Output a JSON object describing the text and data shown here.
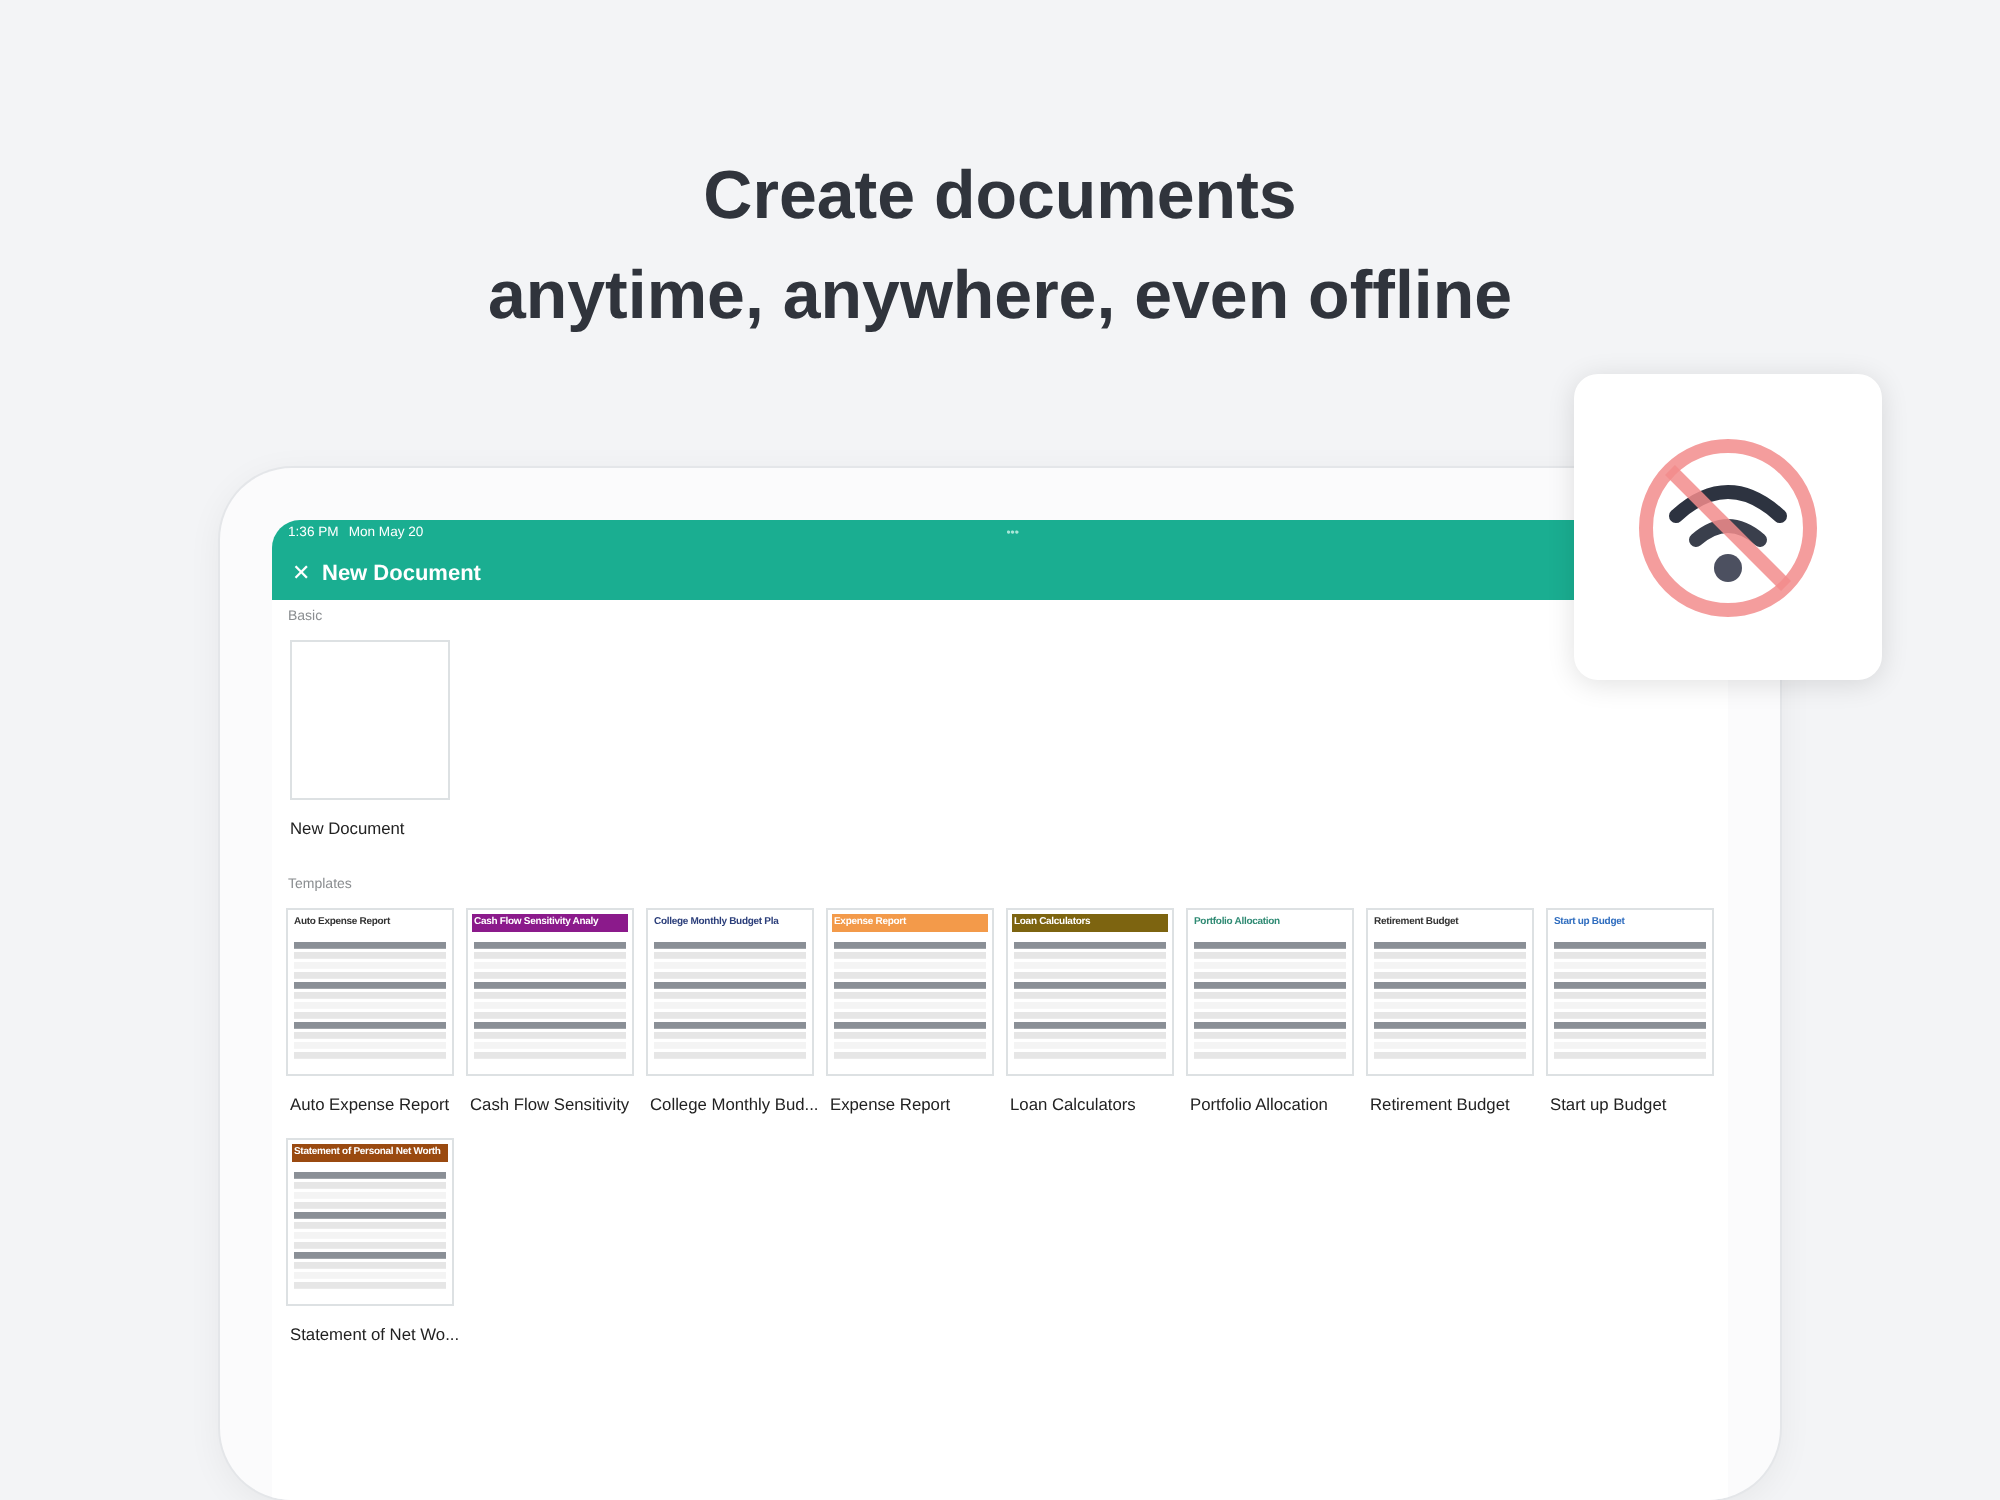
{
  "headline": [
    "Create documents",
    "anytime, anywhere, even offline"
  ],
  "status_bar": {
    "time": "1:36 PM",
    "date": "Mon May 20",
    "dots": "•••"
  },
  "title_bar": {
    "close": "✕",
    "title": "New Document"
  },
  "sections": [
    {
      "label": "Basic",
      "items": [
        {
          "name": "New Document",
          "thumb": {
            "kind": "blank"
          }
        }
      ]
    },
    {
      "label": "Templates",
      "items": [
        {
          "name": "Auto Expense Report",
          "thumb": {
            "kind": "plain",
            "title": "Auto Expense Report",
            "color": "#333333"
          }
        },
        {
          "name": "Cash Flow Sensitivity",
          "thumb": {
            "kind": "banner",
            "title": "Cash Flow Sensitivity Analy",
            "color": "#8b1a8b"
          }
        },
        {
          "name": "College Monthly Bud...",
          "thumb": {
            "kind": "plain",
            "title": "College Monthly Budget Pla",
            "color": "#2b3e7a"
          }
        },
        {
          "name": "Expense Report",
          "thumb": {
            "kind": "banner",
            "title": "Expense Report",
            "color": "#f39a4a"
          }
        },
        {
          "name": "Loan Calculators",
          "thumb": {
            "kind": "banner",
            "title": "Loan Calculators",
            "color": "#7d6410"
          }
        },
        {
          "name": "Portfolio Allocation",
          "thumb": {
            "kind": "plain",
            "title": "Portfolio Allocation",
            "color": "#2f8a73"
          }
        },
        {
          "name": "Retirement Budget",
          "thumb": {
            "kind": "plain",
            "title": "Retirement Budget",
            "color": "#333333"
          }
        },
        {
          "name": "Start up Budget",
          "thumb": {
            "kind": "plain",
            "title": "Start up Budget",
            "color": "#2f6dbf"
          }
        },
        {
          "name": "Statement of Net Wo...",
          "thumb": {
            "kind": "banner",
            "title": "Statement of Personal Net Worth",
            "color": "#9a4a10"
          }
        }
      ]
    }
  ]
}
